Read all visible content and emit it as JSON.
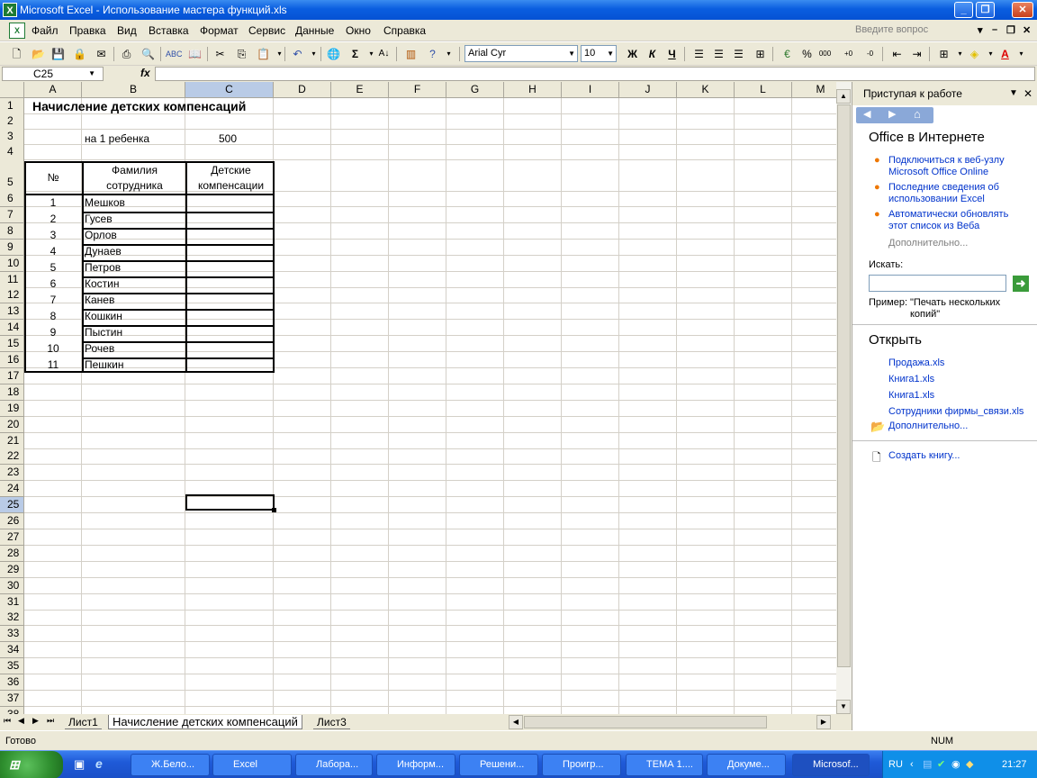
{
  "window": {
    "title": "Microsoft Excel - Использование мастера функций.xls"
  },
  "menu": {
    "items": [
      "Файл",
      "Правка",
      "Вид",
      "Вставка",
      "Формат",
      "Сервис",
      "Данные",
      "Окно",
      "Справка"
    ],
    "ask_placeholder": "Введите вопрос"
  },
  "toolbar": {
    "font": "Arial Cyr",
    "size": "10",
    "bold": "Ж",
    "italic": "К",
    "underline": "Ч",
    "sum": "Σ",
    "percent": "%",
    "thousands": "000"
  },
  "formula_bar": {
    "cell_ref": "C25",
    "fx": "fx",
    "value": ""
  },
  "columns": [
    "A",
    "B",
    "C",
    "D",
    "E",
    "F",
    "G",
    "H",
    "I",
    "J",
    "K",
    "L",
    "M"
  ],
  "rows": [
    "1",
    "2",
    "3",
    "4",
    "5",
    "6",
    "7",
    "8",
    "9",
    "10",
    "11",
    "12",
    "13",
    "14",
    "15",
    "16",
    "17",
    "18",
    "19",
    "20",
    "21",
    "22",
    "23",
    "24",
    "25",
    "26",
    "27",
    "28",
    "29",
    "30",
    "31",
    "32",
    "33",
    "34",
    "35",
    "36",
    "37",
    "38"
  ],
  "sheet": {
    "title": "Начисление детских компенсаций",
    "per_child_label": "на 1 ребенка",
    "per_child_value": "500",
    "header_num": "№",
    "header_name_1": "Фамилия",
    "header_name_2": "сотрудника",
    "header_comp_1": "Детские",
    "header_comp_2": "компенсации",
    "employees": [
      {
        "n": "1",
        "name": "Мешков"
      },
      {
        "n": "2",
        "name": "Гусев"
      },
      {
        "n": "3",
        "name": "Орлов"
      },
      {
        "n": "4",
        "name": "Дунаев"
      },
      {
        "n": "5",
        "name": "Петров"
      },
      {
        "n": "6",
        "name": "Костин"
      },
      {
        "n": "7",
        "name": "Канев"
      },
      {
        "n": "8",
        "name": "Кошкин"
      },
      {
        "n": "9",
        "name": "Пыстин"
      },
      {
        "n": "10",
        "name": "Рочев"
      },
      {
        "n": "11",
        "name": "Пешкин"
      }
    ]
  },
  "sheet_tabs": [
    "Лист1",
    "Начисление детских компенсаций",
    "Лист3"
  ],
  "task_pane": {
    "title": "Приступая к работе",
    "office_online": "Office в Интернете",
    "links": [
      "Подключиться к веб-узлу Microsoft Office Online",
      "Последние сведения об использовании Excel",
      "Автоматически обновлять этот список из Веба"
    ],
    "more": "Дополнительно...",
    "search_label": "Искать:",
    "example_label": "Пример:",
    "example_text": "\"Печать нескольких копий\"",
    "open_title": "Открыть",
    "files": [
      "Продажа.xls",
      "Книга1.xls",
      "Книга1.xls",
      "Сотрудники фирмы_связи.xls"
    ],
    "more_files": "Дополнительно...",
    "create": "Создать книгу..."
  },
  "status": {
    "ready": "Готово",
    "num": "NUM"
  },
  "taskbar": {
    "tasks": [
      "Ж.Бело...",
      "Excel",
      "Лабора...",
      "Информ...",
      "Решени...",
      "Проигр...",
      "ТЕМА 1....",
      "Докуме...",
      "Microsof..."
    ],
    "lang": "RU",
    "time": "21:27"
  }
}
